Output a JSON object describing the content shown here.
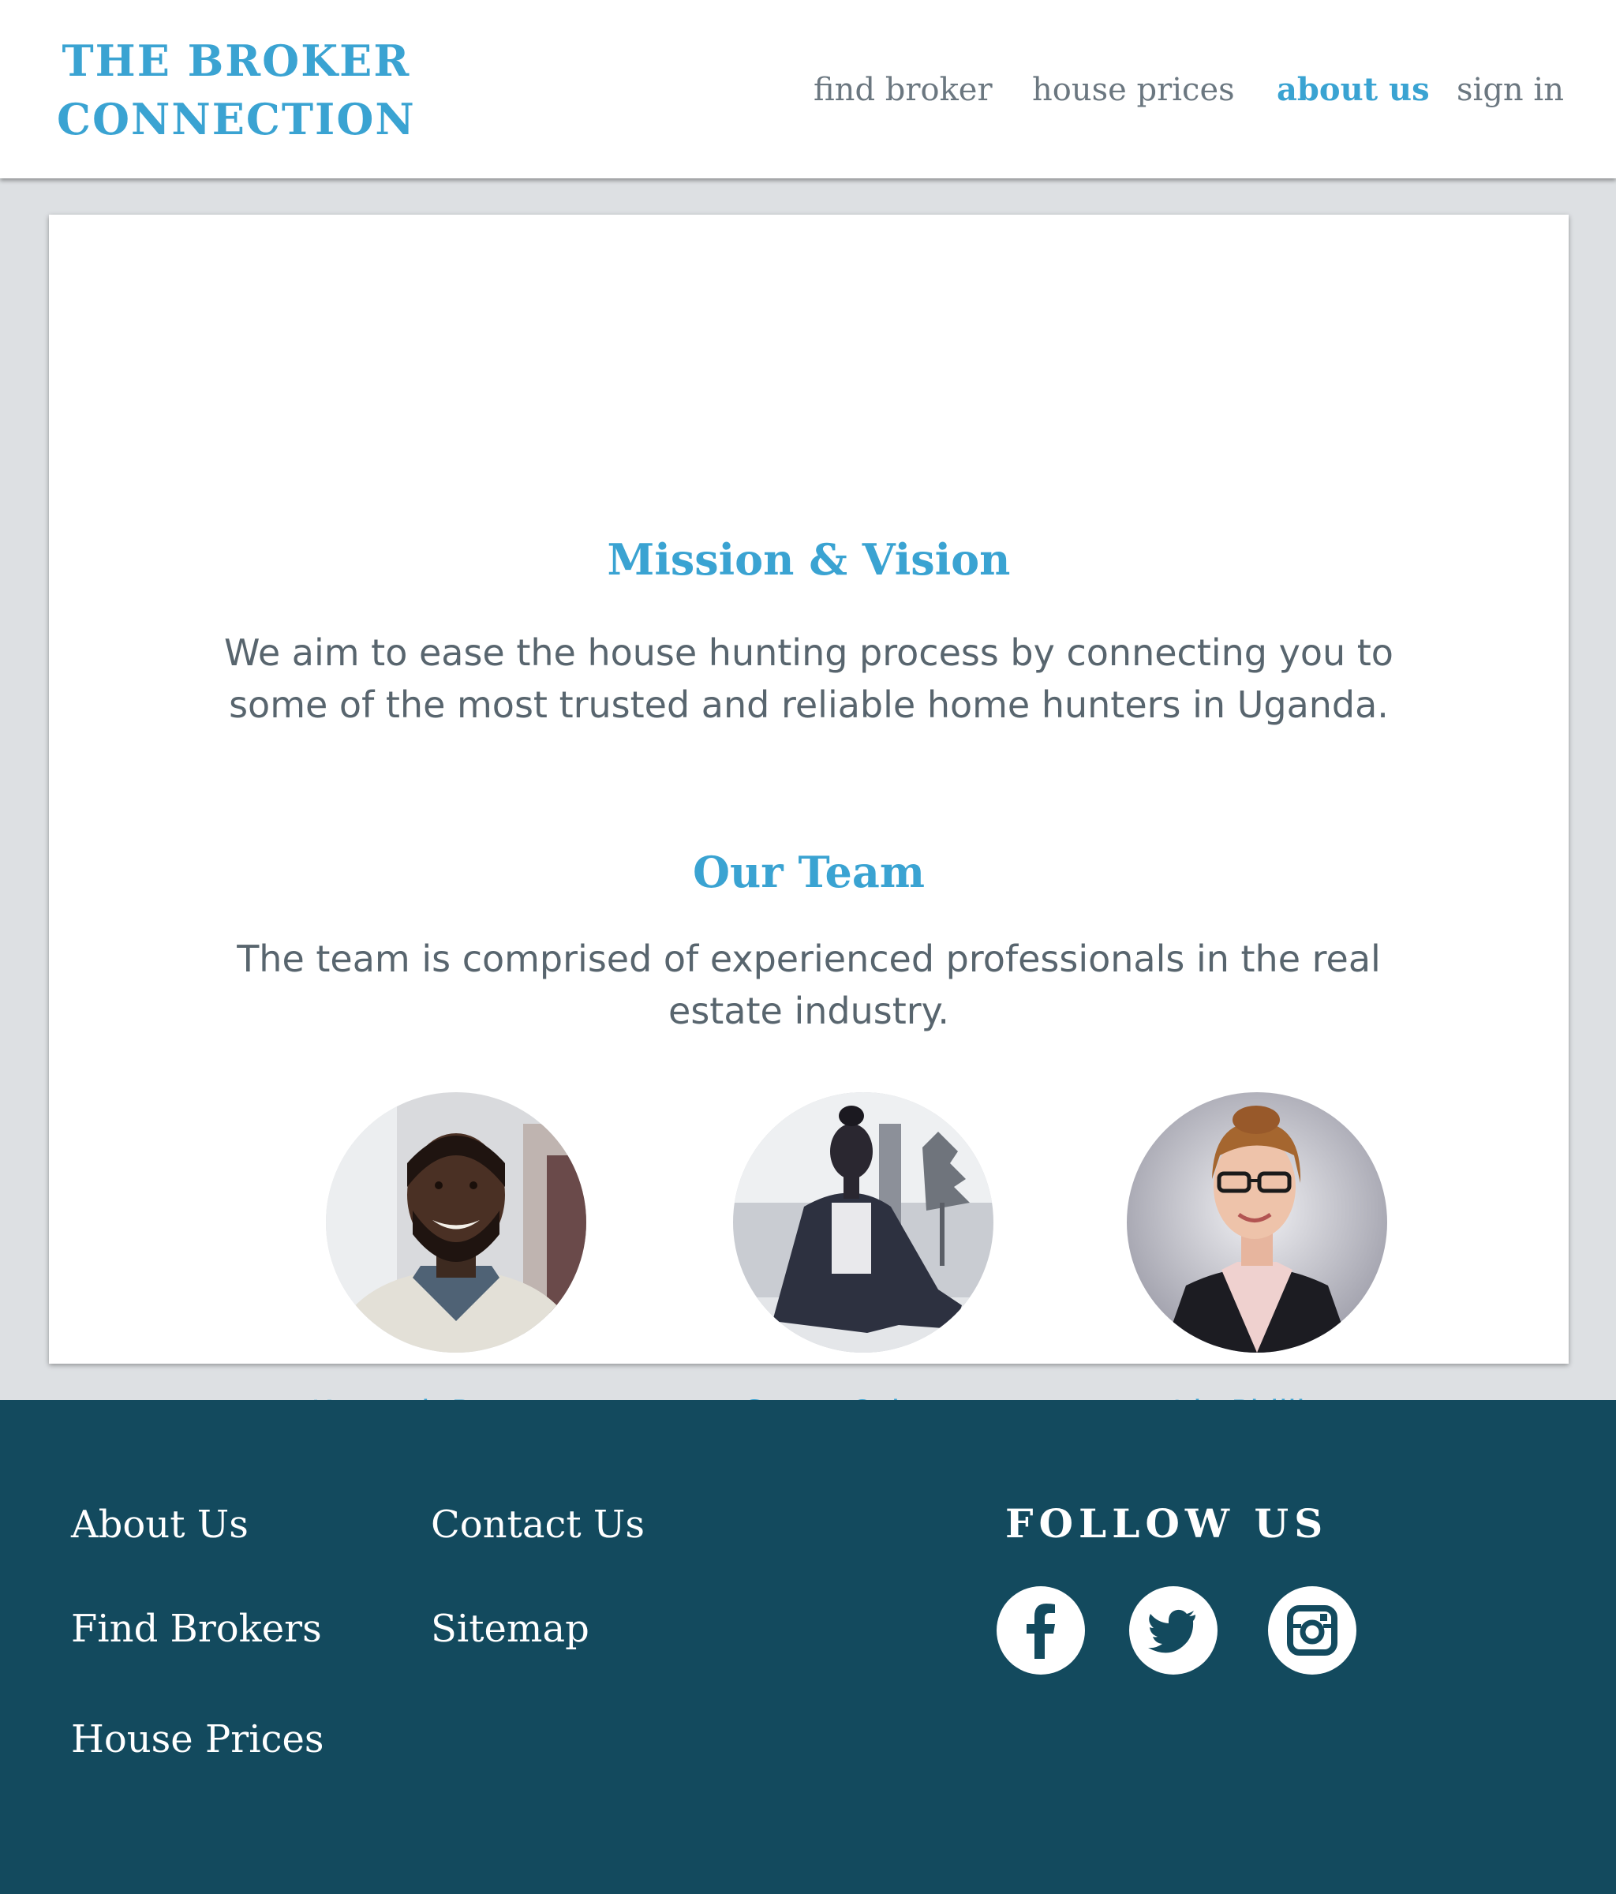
{
  "header": {
    "brand_line1": "THE BROKER",
    "brand_line2": "CONNECTION",
    "nav": {
      "find_broker": "find broker",
      "house_prices": "house prices",
      "about_us": "about us",
      "sign_in": "sign in"
    },
    "active_nav": "about us"
  },
  "main": {
    "mission_title": "Mission & Vision",
    "mission_text": "We aim to ease the house hunting process by connecting you to some of the most trusted and reliable home hunters in Uganda.",
    "team_title": "Our Team",
    "team_text": "The team is comprised of experienced professionals in the real estate industry.",
    "team": [
      {
        "name": "Kenneth Patterson"
      },
      {
        "name": "Susan Osborne"
      },
      {
        "name": "Ida Phillips"
      }
    ]
  },
  "footer": {
    "links": {
      "about_us": "About Us",
      "find_brokers": "Find Brokers",
      "house_prices": "House Prices",
      "contact_us": "Contact Us",
      "sitemap": "Sitemap"
    },
    "follow_title": "FOLLOW US",
    "social_icons": [
      "facebook-icon",
      "twitter-icon",
      "instagram-icon"
    ]
  },
  "colors": {
    "accent": "#3aa3d2",
    "footer_bg": "#134a5e",
    "page_bg": "#dde0e3",
    "text": "#58656e"
  }
}
